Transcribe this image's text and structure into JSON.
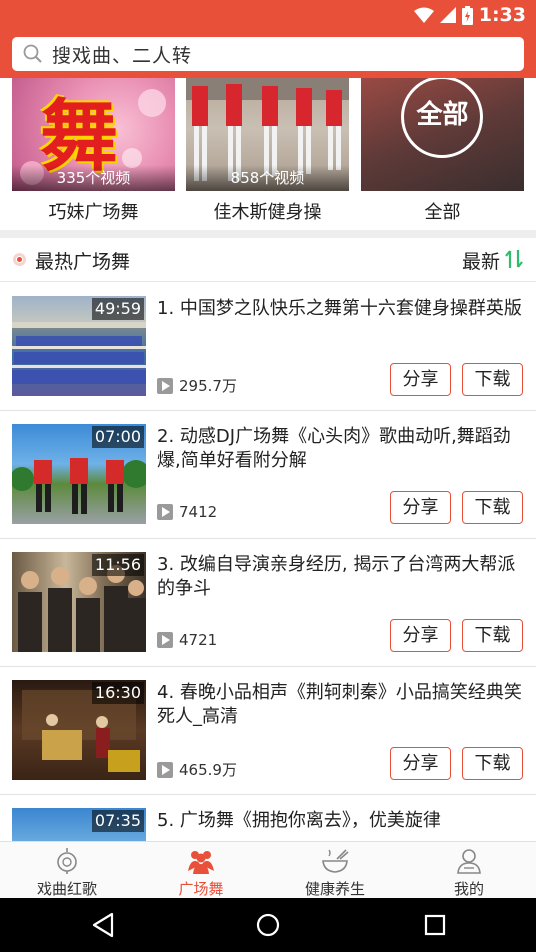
{
  "status": {
    "time": "1:33"
  },
  "search": {
    "placeholder": "搜戏曲、二人转"
  },
  "categories": [
    {
      "label": "巧妹广场舞",
      "count": "335个视频",
      "thumb_text": "舞"
    },
    {
      "label": "佳木斯健身操",
      "count": "858个视频"
    },
    {
      "label": "全部",
      "thumb_text": "全部"
    }
  ],
  "section": {
    "title": "最热广场舞",
    "sort_label": "最新"
  },
  "videos": [
    {
      "duration": "49:59",
      "title": "1. 中国梦之队快乐之舞第十六套健身操群英版",
      "plays": "295.7万",
      "share": "分享",
      "download": "下载"
    },
    {
      "duration": "07:00",
      "title": "2. 动感DJ广场舞《心头肉》歌曲动听,舞蹈劲爆,简单好看附分解",
      "plays": "7412",
      "share": "分享",
      "download": "下载"
    },
    {
      "duration": "11:56",
      "title": "3. 改编自导演亲身经历, 揭示了台湾两大帮派的争斗",
      "plays": "4721",
      "share": "分享",
      "download": "下载"
    },
    {
      "duration": "16:30",
      "title": "4. 春晚小品相声《荆轲刺秦》小品搞笑经典笑死人_高清",
      "plays": "465.9万",
      "share": "分享",
      "download": "下载"
    },
    {
      "duration": "07:35",
      "title": "5. 广场舞《拥抱你离去》，优美旋律"
    }
  ],
  "tabs": [
    {
      "label": "戏曲红歌",
      "icon": "lantern-icon"
    },
    {
      "label": "广场舞",
      "icon": "people-icon",
      "active": true
    },
    {
      "label": "健康养生",
      "icon": "bowl-icon"
    },
    {
      "label": "我的",
      "icon": "user-icon"
    }
  ],
  "colors": {
    "accent": "#e8503a",
    "sort_icon": "#2ebd6b"
  }
}
